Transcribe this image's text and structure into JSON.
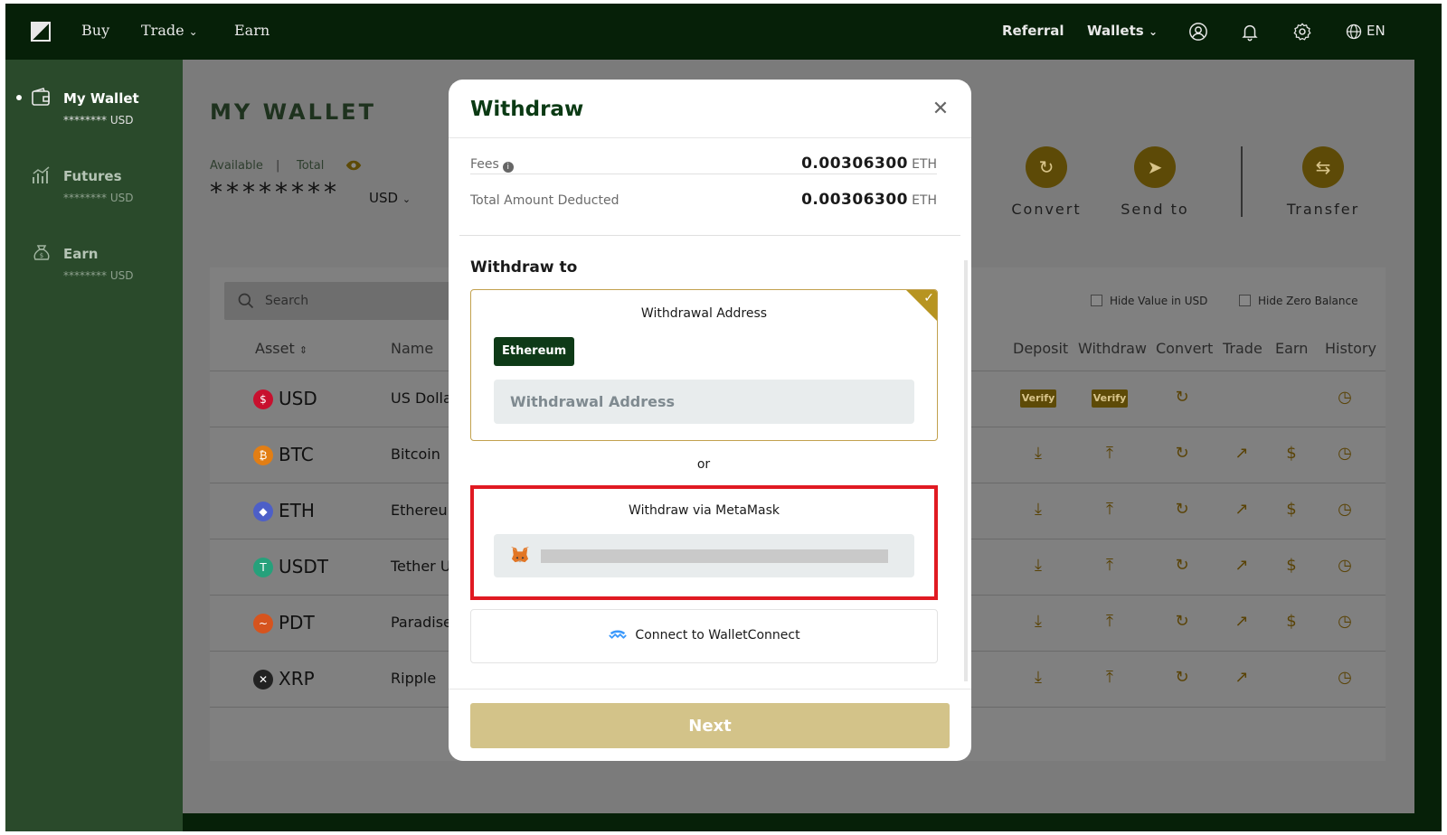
{
  "topnav": {
    "items": [
      "Buy",
      "Trade",
      "Earn"
    ],
    "referral": "Referral",
    "wallets": "Wallets",
    "language": "EN",
    "icons": [
      "user-icon",
      "bell-icon",
      "gear-icon",
      "globe-icon"
    ]
  },
  "sidebar": {
    "items": [
      {
        "label": "My Wallet",
        "sub": "******** USD",
        "icon": "wallet-icon"
      },
      {
        "label": "Futures",
        "sub": "******** USD",
        "icon": "chart-icon"
      },
      {
        "label": "Earn",
        "sub": "******** USD",
        "icon": "money-bag-icon"
      }
    ]
  },
  "wallet": {
    "title": "MY WALLET",
    "available": "Available",
    "total": "Total",
    "balance": "********",
    "currency": "USD",
    "actions": [
      "Convert",
      "Send to",
      "Transfer"
    ],
    "search_placeholder": "Search",
    "hide_value": "Hide Value in USD",
    "hide_zero": "Hide Zero Balance",
    "columns": [
      "Asset",
      "Name",
      "Deposit",
      "Withdraw",
      "Convert",
      "Trade",
      "Earn",
      "History"
    ],
    "verify_label": "Verify",
    "rows": [
      {
        "symbol": "USD",
        "name": "US Dolla",
        "color": "#c8102e"
      },
      {
        "symbol": "BTC",
        "name": "Bitcoin",
        "color": "#e27e14"
      },
      {
        "symbol": "ETH",
        "name": "Ethereur",
        "color": "#4d5fc8"
      },
      {
        "symbol": "USDT",
        "name": "Tether U",
        "color": "#26a17b"
      },
      {
        "symbol": "PDT",
        "name": "Paradise",
        "color": "#d6541e"
      },
      {
        "symbol": "XRP",
        "name": "Ripple",
        "color": "#222222"
      }
    ]
  },
  "modal": {
    "title": "Withdraw",
    "fees_label": "Fees",
    "fees_value": "0.00306300",
    "fees_unit": "ETH",
    "total_label": "Total Amount Deducted",
    "total_value": "0.00306300",
    "total_unit": "ETH",
    "withdraw_to": "Withdraw to",
    "address_card_title": "Withdrawal Address",
    "network_tag": "Ethereum",
    "address_placeholder": "Withdrawal Address",
    "or": "or",
    "metamask_title": "Withdraw via MetaMask",
    "walletconnect": "Connect to WalletConnect",
    "next": "Next"
  }
}
